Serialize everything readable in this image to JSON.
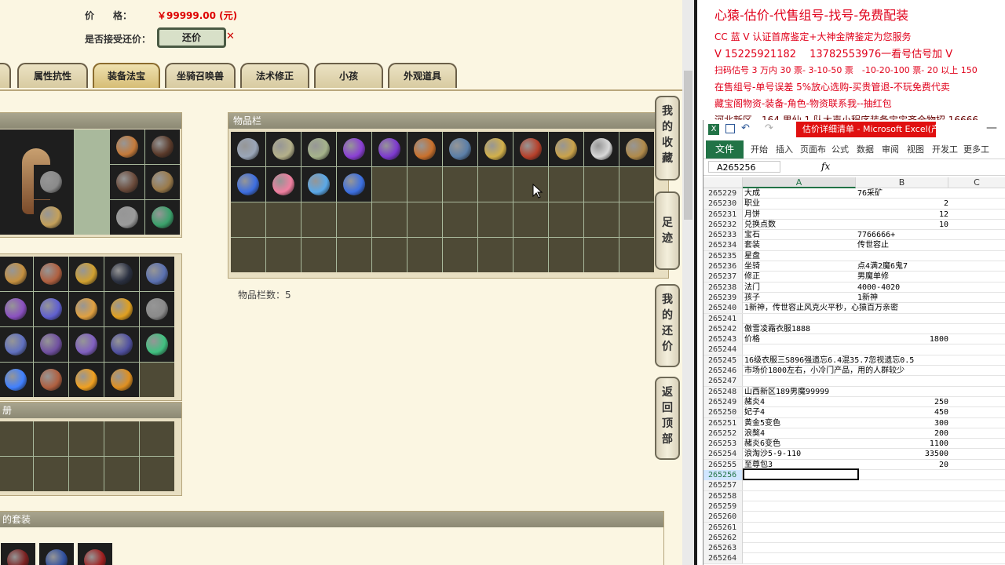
{
  "game": {
    "price_label": "价　　格：",
    "price_value": "￥99999.00 (元)",
    "bargain_label": "是否接受还价：",
    "bargain_button": "还价",
    "close_glyph": "✕",
    "tabs": [
      {
        "label": "属性抗性",
        "active": false
      },
      {
        "label": "装备法宝",
        "active": true
      },
      {
        "label": "坐骑召唤兽",
        "active": false
      },
      {
        "label": "法术修正",
        "active": false
      },
      {
        "label": "小孩",
        "active": false
      },
      {
        "label": "外观道具",
        "active": false
      }
    ],
    "inventory_title": "物品栏",
    "inventory_count": "物品栏数：5",
    "album_title": "册",
    "suit_title": "的套装",
    "side_buttons": [
      "我的收藏",
      "足迹",
      "我的还价",
      "返回顶部"
    ],
    "inventory_items": [
      "#9aa6b8",
      "#b4b08a",
      "#a5b38b",
      "#8a3fd4",
      "#7d39cf",
      "#c9702c",
      "#5b7fa8",
      "#d2b04a",
      "#b7402a",
      "#caa24a",
      "#d8d8d8",
      "#b08a4a",
      "#3d6ee0",
      "#f07fa0",
      "#5aa8e8",
      "#3c6fe0"
    ],
    "equip_colors": [
      "#7a3a2a",
      "#c47a3a",
      "#5a3a2a",
      "#8a8a8a",
      "#6a4a3a",
      "#9a7a4a",
      "#c4a05a",
      "#9a9a9a",
      "#3aa06a"
    ],
    "fabao_colors": [
      "#c49040",
      "#b06040",
      "#d0a030",
      "#2a3040",
      "#5a70b0",
      "#8a50c0",
      "#6060d0",
      "#e0a040",
      "#e0a020",
      "#8a8a8a",
      "#6070c0",
      "#7050a0",
      "#8060c0",
      "#5050a0",
      "#40c080",
      "#4080ff",
      "#b06040",
      "#f0a020",
      "#e09020"
    ],
    "suit_colors": [
      "#7a2020",
      "#3050a0",
      "#a02020"
    ]
  },
  "notes": [
    "心猿-估价-代售组号-找号-免费配装",
    "CC 蓝 V 认证首席鉴定+大神金牌鉴定为您服务",
    "V 15225921182　 13782553976一看号估号加 V",
    "扫码估号 3 万内 30 票- 3-10-50 票　-10-20-100 票- 20 以上 150",
    "在售组号-单号误差 5%放心选购-买贵管退-不玩免费代卖",
    "藏宝阁物资-装备-角色-物资联系我--抽红包",
    "河北新区　164 男仙 1 队大声小程序装备宝宝齐全物招 16666"
  ],
  "excel": {
    "window_title": "估价详细清单 - Microsoft Excel(产品...",
    "file_tab": "文件",
    "ribbon_tabs": [
      "开始",
      "插入",
      "页面布",
      "公式",
      "数据",
      "审阅",
      "视图",
      "开发工",
      "更多工"
    ],
    "name_box": "A265256",
    "fx": "fx",
    "col_headers": [
      "A",
      "B",
      "C"
    ],
    "rows": [
      {
        "n": "265229",
        "a": "大成",
        "b": "76采矿",
        "num": false
      },
      {
        "n": "265230",
        "a": "职业",
        "b": "2",
        "num": true
      },
      {
        "n": "265231",
        "a": "月饼",
        "b": "12",
        "num": true
      },
      {
        "n": "265232",
        "a": "兑换点数",
        "b": "10",
        "num": true
      },
      {
        "n": "265233",
        "a": "宝石",
        "b": "7766666+",
        "num": false
      },
      {
        "n": "265234",
        "a": "套装",
        "b": "传世容止",
        "num": false
      },
      {
        "n": "265235",
        "a": "星盘",
        "b": "",
        "num": false
      },
      {
        "n": "265236",
        "a": "坐骑",
        "b": "点4满2魔6鬼7",
        "num": false
      },
      {
        "n": "265237",
        "a": "修正",
        "b": "男魔单修",
        "num": false
      },
      {
        "n": "265238",
        "a": "法门",
        "b": "4000-4020",
        "num": false
      },
      {
        "n": "265239",
        "a": "孩子",
        "b": "1新神",
        "num": false
      },
      {
        "n": "265240",
        "a": "1新神，传世容止风克火平秒，心猿百万亲密",
        "b": "",
        "num": false
      },
      {
        "n": "265241",
        "a": "",
        "b": "",
        "num": false
      },
      {
        "n": "265242",
        "a": "傲雪凌霜衣服1888",
        "b": "",
        "num": false
      },
      {
        "n": "265243",
        "a": "价格",
        "b": "1800",
        "num": true
      },
      {
        "n": "265244",
        "a": "",
        "b": "",
        "num": false
      },
      {
        "n": "265245",
        "a": "16级衣服三S896强遗忘6.4混35.7忽视遗忘0.5",
        "b": "",
        "num": false
      },
      {
        "n": "265246",
        "a": "市场价1800左右，小冷门产品，用的人群较少",
        "b": "",
        "num": false
      },
      {
        "n": "265247",
        "a": "",
        "b": "",
        "num": false
      },
      {
        "n": "265248",
        "a": "山西新区189男魔99999",
        "b": "",
        "num": false
      },
      {
        "n": "265249",
        "a": "赭炎4",
        "b": "250",
        "num": true
      },
      {
        "n": "265250",
        "a": "妃子4",
        "b": "450",
        "num": true
      },
      {
        "n": "265251",
        "a": "黄金5变色",
        "b": "300",
        "num": true
      },
      {
        "n": "265252",
        "a": "浪獒4",
        "b": "200",
        "num": true
      },
      {
        "n": "265253",
        "a": "赭炎6变色",
        "b": "1100",
        "num": true
      },
      {
        "n": "265254",
        "a": "浪淘沙5-9-110",
        "b": "33500",
        "num": true
      },
      {
        "n": "265255",
        "a": "至尊包3",
        "b": "20",
        "num": true
      },
      {
        "n": "265256",
        "a": "",
        "b": "",
        "num": false,
        "sel": true
      },
      {
        "n": "265257",
        "a": "",
        "b": "",
        "num": false
      },
      {
        "n": "265258",
        "a": "",
        "b": "",
        "num": false
      },
      {
        "n": "265259",
        "a": "",
        "b": "",
        "num": false
      },
      {
        "n": "265260",
        "a": "",
        "b": "",
        "num": false
      },
      {
        "n": "265261",
        "a": "",
        "b": "",
        "num": false
      },
      {
        "n": "265262",
        "a": "",
        "b": "",
        "num": false
      },
      {
        "n": "265263",
        "a": "",
        "b": "",
        "num": false
      },
      {
        "n": "265264",
        "a": "",
        "b": "",
        "num": false
      }
    ]
  }
}
